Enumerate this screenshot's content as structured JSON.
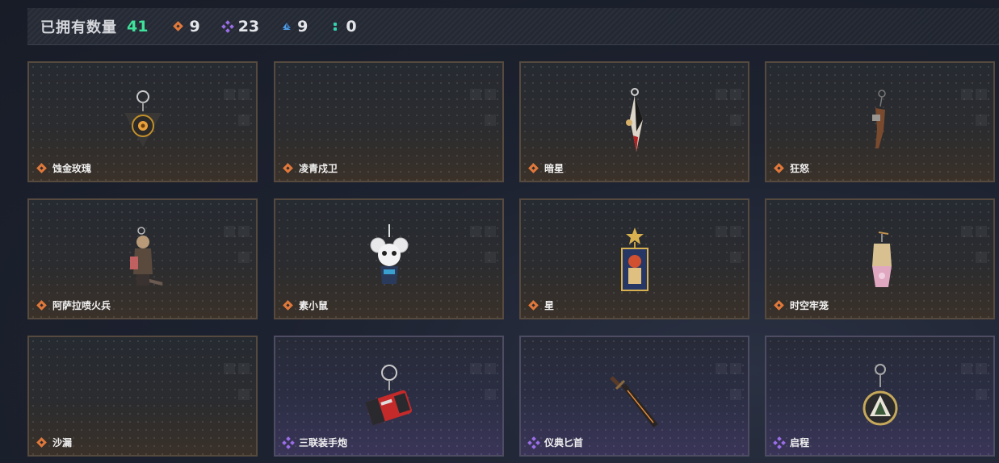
{
  "summary": {
    "owned_label": "已拥有数量",
    "owned_count": "41",
    "stats": [
      {
        "icon": "orange-diamond-icon",
        "value": "9",
        "color": "#e0783a"
      },
      {
        "icon": "purple-diamond-icon",
        "value": "23",
        "color": "#9b6ee8"
      },
      {
        "icon": "blue-triangle-icon",
        "value": "9",
        "color": "#4f9de6"
      },
      {
        "icon": "teal-dots-icon",
        "value": "0",
        "color": "#35d2b0"
      }
    ]
  },
  "items": [
    {
      "name": "蚀金玫瑰",
      "rarity": "orange",
      "art": "rose-pendant"
    },
    {
      "name": "凌青戍卫",
      "rarity": "orange",
      "art": "none"
    },
    {
      "name": "暗星",
      "rarity": "orange",
      "art": "star-feather"
    },
    {
      "name": "狂怒",
      "rarity": "orange",
      "art": "fury-charm"
    },
    {
      "name": "阿萨拉喷火兵",
      "rarity": "orange",
      "art": "flamethrower-soldier"
    },
    {
      "name": "素小鼠",
      "rarity": "orange",
      "art": "mouse-charm"
    },
    {
      "name": "星",
      "rarity": "orange",
      "art": "tarot-star"
    },
    {
      "name": "时空牢笼",
      "rarity": "orange",
      "art": "time-cage"
    },
    {
      "name": "沙漏",
      "rarity": "orange",
      "art": "none"
    },
    {
      "name": "三联装手炮",
      "rarity": "purple",
      "art": "triple-hand-cannon"
    },
    {
      "name": "仪典匕首",
      "rarity": "purple",
      "art": "ceremonial-dagger"
    },
    {
      "name": "启程",
      "rarity": "purple",
      "art": "departure-medal"
    }
  ]
}
